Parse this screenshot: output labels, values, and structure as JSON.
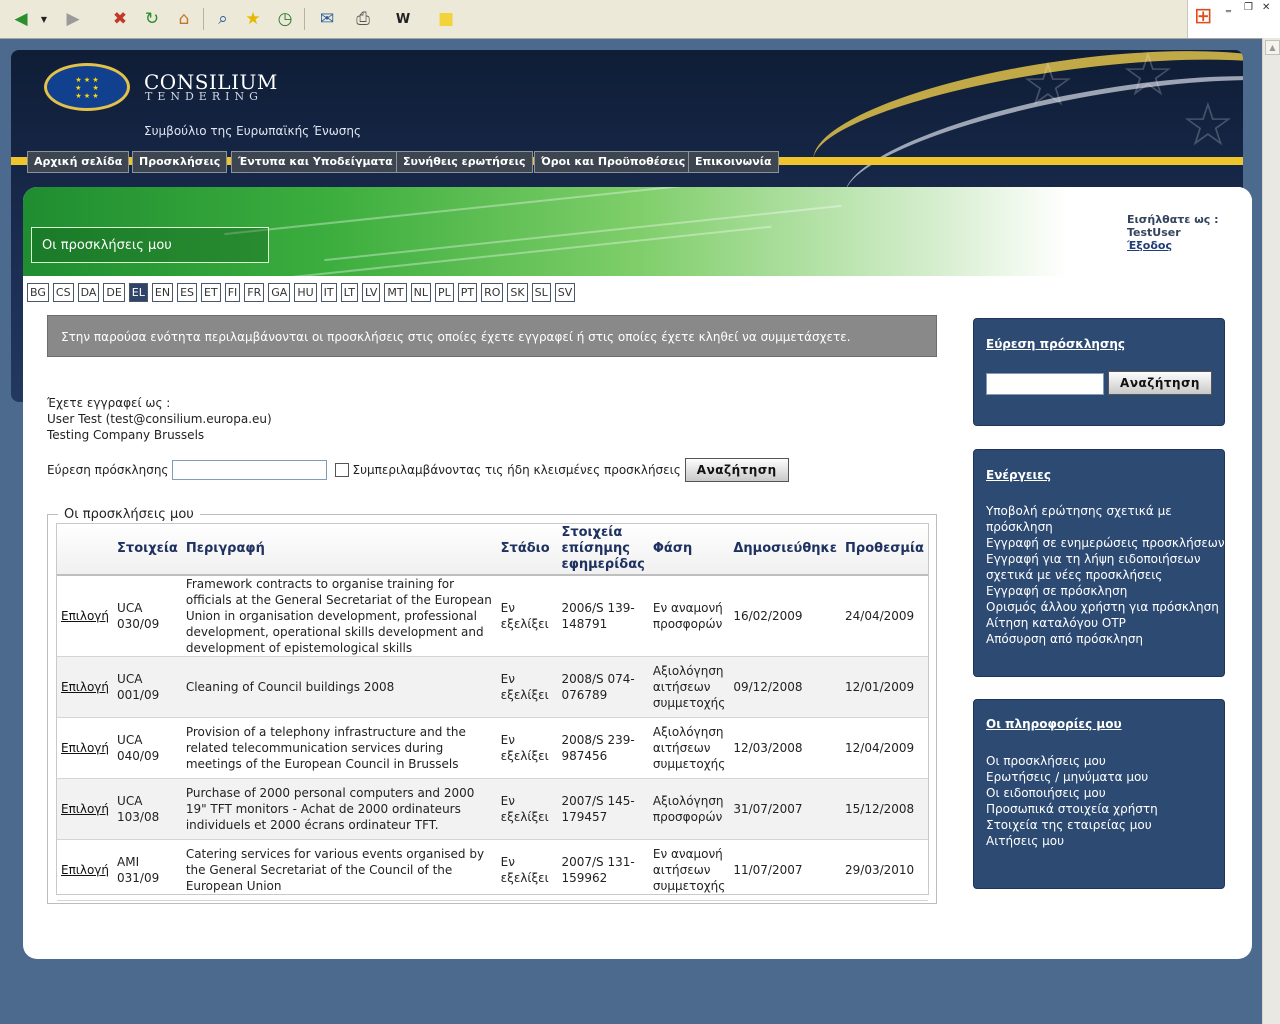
{
  "browser": {
    "toolbar_icons": [
      "back-icon",
      "dropdown-arrow-icon",
      "forward-icon",
      "stop-icon",
      "refresh-icon",
      "home-icon",
      "search-icon",
      "favorites-icon",
      "history-icon",
      "mail-icon",
      "print-icon",
      "edit-icon",
      "note-icon"
    ]
  },
  "header": {
    "brand_name": "CONSILIUM",
    "brand_sub": "TENDERING",
    "subtitle": "Συμβούλιο της Ευρωπαϊκής Ένωσης"
  },
  "nav": [
    {
      "label": "Αρχική σελίδα"
    },
    {
      "label": "Προσκλήσεις"
    },
    {
      "label": "Έντυπα και Υποδείγματα"
    },
    {
      "label": "Συνήθεις ερωτήσεις"
    },
    {
      "label": "Όροι και Προϋποθέσεις"
    },
    {
      "label": "Επικοινωνία"
    }
  ],
  "page": {
    "title": "Οι προσκλήσεις μου",
    "logged_in_label": "Εισήλθατε ως :",
    "username": "TestUser",
    "logout": "Έξοδος"
  },
  "languages": [
    "BG",
    "CS",
    "DA",
    "DE",
    "EL",
    "EN",
    "ES",
    "ET",
    "FI",
    "FR",
    "GA",
    "HU",
    "IT",
    "LT",
    "LV",
    "MT",
    "NL",
    "PL",
    "PT",
    "RO",
    "SK",
    "SL",
    "SV"
  ],
  "selected_language": "EL",
  "info_text": "Στην παρούσα ενότητα περιλαμβάνονται οι προσκλήσεις στις οποίες έχετε εγγραφεί ή στις οποίες έχετε κληθεί να συμμετάσχετε.",
  "registration": {
    "label": "Έχετε εγγραφεί ως :",
    "user": "User Test (test@consilium.europa.eu)",
    "company": "Testing Company Brussels"
  },
  "search": {
    "label": "Εύρεση πρόσκλησης",
    "value": "",
    "checkbox_label": "Συμπεριλαμβάνοντας τις ήδη κλεισμένες προσκλήσεις",
    "button": "Αναζήτηση"
  },
  "table": {
    "legend": "Οι προσκλήσεις μου",
    "headers": [
      "",
      "Στοιχεία",
      "Περιγραφή",
      "Στάδιο",
      "Στοιχεία επίσημης εφημερίδας",
      "Φάση",
      "Δημοσιεύθηκε",
      "Προθεσμία"
    ],
    "rows": [
      {
        "select": "Επιλογή",
        "ref": "UCA 030/09",
        "desc": "Framework contracts to organise training for officials at the General Secretariat of the European Union in organisation development, professional development, operational skills development and development of epistemological skills",
        "stage": "Εν εξελίξει",
        "oj": "2006/S 139-148791",
        "phase": "Εν αναμονή προσφορών",
        "published": "16/02/2009",
        "deadline": "24/04/2009"
      },
      {
        "select": "Επιλογή",
        "ref": "UCA 001/09",
        "desc": "Cleaning of Council buildings 2008",
        "stage": "Εν εξελίξει",
        "oj": "2008/S 074-076789",
        "phase": "Αξιολόγηση αιτήσεων συμμετοχής",
        "published": "09/12/2008",
        "deadline": "12/01/2009"
      },
      {
        "select": "Επιλογή",
        "ref": "UCA 040/09",
        "desc": "Provision of a telephony infrastructure and the related telecommunication services during meetings of the European Council in Brussels",
        "stage": "Εν εξελίξει",
        "oj": "2008/S 239-987456",
        "phase": "Αξιολόγηση αιτήσεων συμμετοχής",
        "published": "12/03/2008",
        "deadline": "12/04/2009"
      },
      {
        "select": "Επιλογή",
        "ref": "UCA 103/08",
        "desc": "Purchase of 2000 personal computers and 2000 19\" TFT monitors - Achat de 2000 ordinateurs individuels et 2000 écrans ordinateur TFT.",
        "stage": "Εν εξελίξει",
        "oj": "2007/S 145-179457",
        "phase": "Αξιολόγηση προσφορών",
        "published": "31/07/2007",
        "deadline": "15/12/2008"
      },
      {
        "select": "Επιλογή",
        "ref": "AMI 031/09",
        "desc": "Catering services for various events organised by the General Secretariat of the Council of the European Union",
        "stage": "Εν εξελίξει",
        "oj": "2007/S 131-159962",
        "phase": "Εν αναμονή αιτήσεων συμμετοχής",
        "published": "11/07/2007",
        "deadline": "29/03/2010"
      }
    ]
  },
  "sidebar": {
    "find": {
      "title": "Εύρεση πρόσκλησης",
      "value": "",
      "button": "Αναζήτηση"
    },
    "actions": {
      "title": "Ενέργειες",
      "items": [
        "Υποβολή ερώτησης σχετικά με",
        "πρόσκληση",
        "Εγγραφή σε ενημερώσεις προσκλήσεων",
        "Εγγραφή για τη λήψη ειδοποιήσεων",
        "σχετικά με νέες προσκλήσεις",
        "Εγγραφή σε πρόσκληση",
        "Ορισμός άλλου χρήστη για πρόσκληση",
        "Αίτηση καταλόγου OTP",
        "Απόσυρση από πρόσκληση"
      ]
    },
    "info": {
      "title": "Οι πληροφορίες μου",
      "items": [
        "Οι προσκλήσεις μου",
        "Ερωτήσεις / μηνύματα μου",
        "Οι ειδοποιήσεις μου",
        "Προσωπικά στοιχεία χρήστη",
        "Στοιχεία της εταιρείας μου",
        "Αιτήσεις μου"
      ]
    }
  },
  "colors": {
    "page_bg": "#4b6a8e",
    "banner": "#0f1d36",
    "nav_bar": "#f0c42c",
    "sidebar_box": "#2d4a72",
    "header_text": "#1e3160"
  }
}
